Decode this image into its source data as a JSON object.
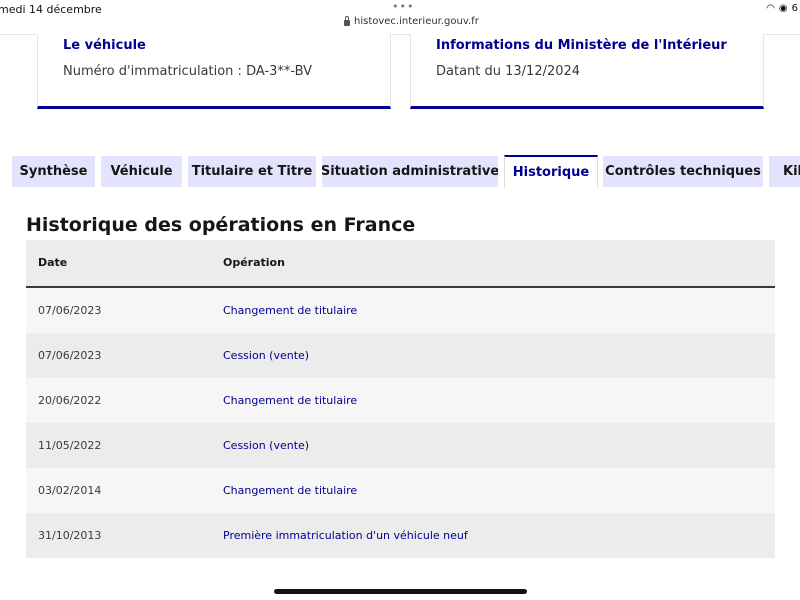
{
  "status_bar": {
    "date": "medi 14 décembre",
    "url": "histovec.interieur.gouv.fr",
    "dots": "•••",
    "right": "6"
  },
  "cards": [
    {
      "title": "Le véhicule",
      "text": "Numéro d'immatriculation : DA-3**-BV"
    },
    {
      "title": "Informations du Ministère de l'Intérieur",
      "text": "Datant du 13/12/2024"
    }
  ],
  "tabs": [
    {
      "label": "Synthèse",
      "active": false
    },
    {
      "label": "Véhicule",
      "active": false
    },
    {
      "label": "Titulaire et Titre",
      "active": false
    },
    {
      "label": "Situation administrative",
      "active": false
    },
    {
      "label": "Historique",
      "active": true
    },
    {
      "label": "Contrôles techniques",
      "active": false
    },
    {
      "label": "Kilo",
      "active": false
    }
  ],
  "section": {
    "title": "Historique des opérations en France"
  },
  "table": {
    "headers": {
      "date": "Date",
      "operation": "Opération"
    },
    "rows": [
      {
        "date": "07/06/2023",
        "operation": "Changement de titulaire"
      },
      {
        "date": "07/06/2023",
        "operation": "Cession (vente)"
      },
      {
        "date": "20/06/2022",
        "operation": "Changement de titulaire"
      },
      {
        "date": "11/05/2022",
        "operation": "Cession (vente)"
      },
      {
        "date": "03/02/2014",
        "operation": "Changement de titulaire"
      },
      {
        "date": "31/10/2013",
        "operation": "Première immatriculation d'un véhicule neuf"
      }
    ]
  },
  "colors": {
    "accent": "#000091",
    "tab_bg": "#e3e3fd",
    "row_odd": "#f6f6f6",
    "row_even": "#ececec"
  }
}
